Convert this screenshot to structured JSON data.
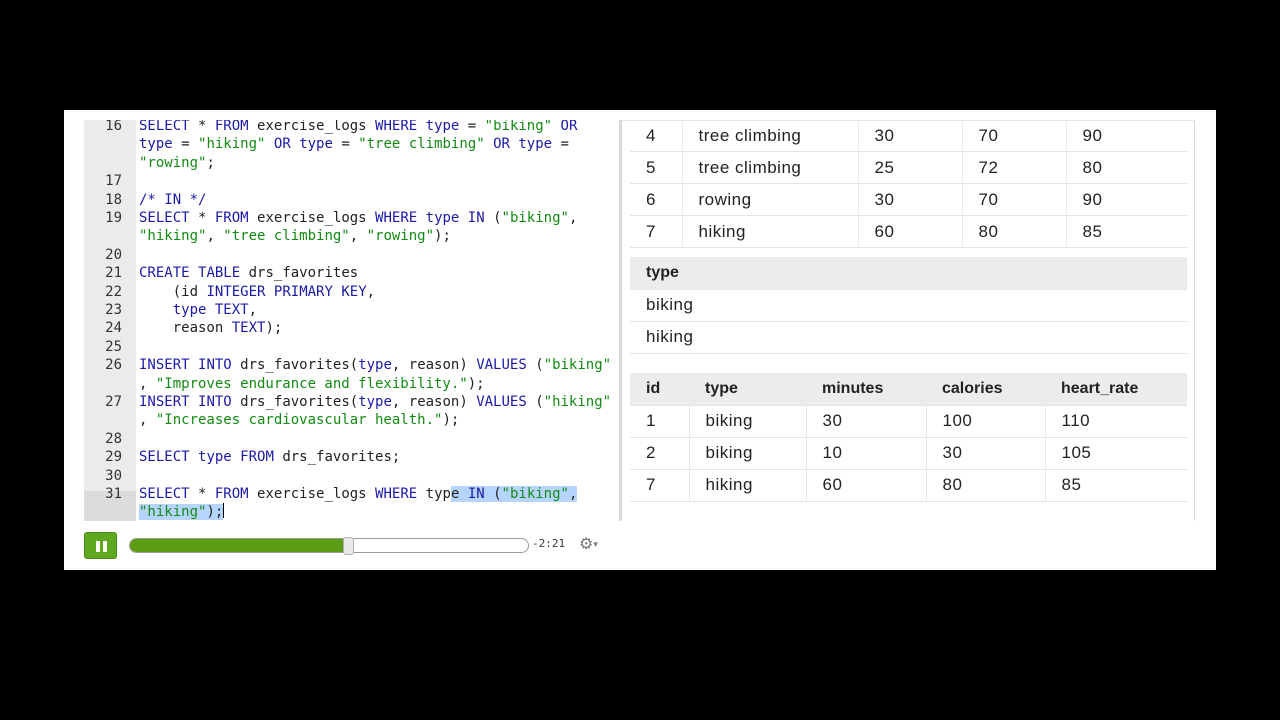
{
  "editor": {
    "lines": [
      {
        "num": "16",
        "text": "SELECT * FROM exercise_logs WHERE type = \"biking\" OR"
      },
      {
        "num": "",
        "text": "type = \"hiking\" OR type = \"tree climbing\" OR type ="
      },
      {
        "num": "",
        "text": "\"rowing\";"
      },
      {
        "num": "17",
        "text": ""
      },
      {
        "num": "18",
        "text": "/* IN */"
      },
      {
        "num": "19",
        "text": "SELECT * FROM exercise_logs WHERE type IN (\"biking\","
      },
      {
        "num": "",
        "text": "\"hiking\", \"tree climbing\", \"rowing\");"
      },
      {
        "num": "20",
        "text": ""
      },
      {
        "num": "21",
        "text": "CREATE TABLE drs_favorites"
      },
      {
        "num": "22",
        "text": "    (id INTEGER PRIMARY KEY,"
      },
      {
        "num": "23",
        "text": "    type TEXT,"
      },
      {
        "num": "24",
        "text": "    reason TEXT);"
      },
      {
        "num": "25",
        "text": ""
      },
      {
        "num": "26",
        "text": "INSERT INTO drs_favorites(type, reason) VALUES (\"biking\""
      },
      {
        "num": "",
        "text": ", \"Improves endurance and flexibility.\");"
      },
      {
        "num": "27",
        "text": "INSERT INTO drs_favorites(type, reason) VALUES (\"hiking\""
      },
      {
        "num": "",
        "text": ", \"Increases cardiovascular health.\");"
      },
      {
        "num": "28",
        "text": ""
      },
      {
        "num": "29",
        "text": "SELECT type FROM drs_favorites;"
      },
      {
        "num": "30",
        "text": ""
      },
      {
        "num": "31",
        "text": "SELECT * FROM exercise_logs WHERE type IN (\"biking\","
      },
      {
        "num": "",
        "text": "\"hiking\");"
      }
    ]
  },
  "results": {
    "table1": {
      "rows": [
        [
          "4",
          "tree climbing",
          "30",
          "70",
          "90"
        ],
        [
          "5",
          "tree climbing",
          "25",
          "72",
          "80"
        ],
        [
          "6",
          "rowing",
          "30",
          "70",
          "90"
        ],
        [
          "7",
          "hiking",
          "60",
          "80",
          "85"
        ]
      ]
    },
    "table2": {
      "header": "type",
      "rows": [
        "biking",
        "hiking"
      ]
    },
    "table3": {
      "headers": [
        "id",
        "type",
        "minutes",
        "calories",
        "heart_rate"
      ],
      "rows": [
        [
          "1",
          "biking",
          "30",
          "100",
          "110"
        ],
        [
          "2",
          "biking",
          "10",
          "30",
          "105"
        ],
        [
          "7",
          "hiking",
          "60",
          "80",
          "85"
        ]
      ]
    }
  },
  "player": {
    "time_remaining": "-2:21",
    "progress": 0.55,
    "play_icon": "pause-icon",
    "settings_icon": "gear-icon",
    "accent_color": "#5ea81f"
  }
}
